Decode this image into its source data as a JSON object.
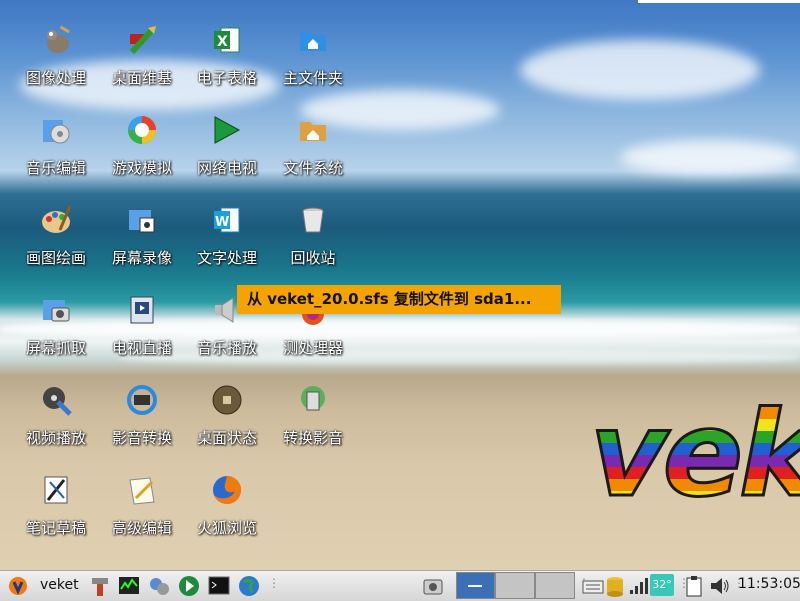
{
  "desktop": {
    "icons": [
      {
        "label": "图像处理",
        "icon": "gimp-icon"
      },
      {
        "label": "桌面维基",
        "icon": "wiki-icon"
      },
      {
        "label": "电子表格",
        "icon": "spreadsheet-icon"
      },
      {
        "label": "主文件夹",
        "icon": "home-folder-icon"
      },
      {
        "label": "音乐编辑",
        "icon": "audio-editor-icon"
      },
      {
        "label": "游戏模拟",
        "icon": "game-emulator-icon"
      },
      {
        "label": "网络电视",
        "icon": "play-icon"
      },
      {
        "label": "文件系统",
        "icon": "filesystem-folder-icon"
      },
      {
        "label": "画图绘画",
        "icon": "paint-palette-icon"
      },
      {
        "label": "屏幕录像",
        "icon": "screen-record-icon"
      },
      {
        "label": "文字处理",
        "icon": "word-processor-icon"
      },
      {
        "label": "回收站",
        "icon": "trash-icon"
      },
      {
        "label": "屏幕抓取",
        "icon": "screenshot-icon"
      },
      {
        "label": "电视直播",
        "icon": "tv-live-icon"
      },
      {
        "label": "音乐播放",
        "icon": "speaker-icon"
      },
      {
        "label": "测处理器",
        "icon": "cpu-test-icon"
      },
      {
        "label": "视频播放",
        "icon": "video-player-icon"
      },
      {
        "label": "影音转换",
        "icon": "media-convert-icon"
      },
      {
        "label": "桌面状态",
        "icon": "desktop-status-icon"
      },
      {
        "label": "转换影音",
        "icon": "convert-media-icon"
      },
      {
        "label": "笔记草稿",
        "icon": "notes-icon"
      },
      {
        "label": "高级编辑",
        "icon": "text-editor-icon"
      },
      {
        "label": "火狐浏览",
        "icon": "firefox-icon"
      }
    ],
    "notification": "从 veket_20.0.sfs 复制文件到 sda1...",
    "wallpaper_logo": "veket"
  },
  "taskbar": {
    "start_label": "veket",
    "launchers": [
      "settings-brush-icon",
      "system-monitor-icon",
      "network-tools-icon",
      "media-play-icon",
      "terminal-icon",
      "browser-globe-icon"
    ],
    "tray": [
      "screenshot-tray-icon",
      "keyboard-icon",
      "disk-icon",
      "signal-icon",
      "temperature-badge",
      "clipboard-icon",
      "volume-icon"
    ],
    "temperature": "32°",
    "clock": "11:53:05"
  },
  "colors": {
    "notification_bg": "#f5a300",
    "pager_active": "#3b6fb6",
    "temp_badge": "#39c7b8"
  }
}
